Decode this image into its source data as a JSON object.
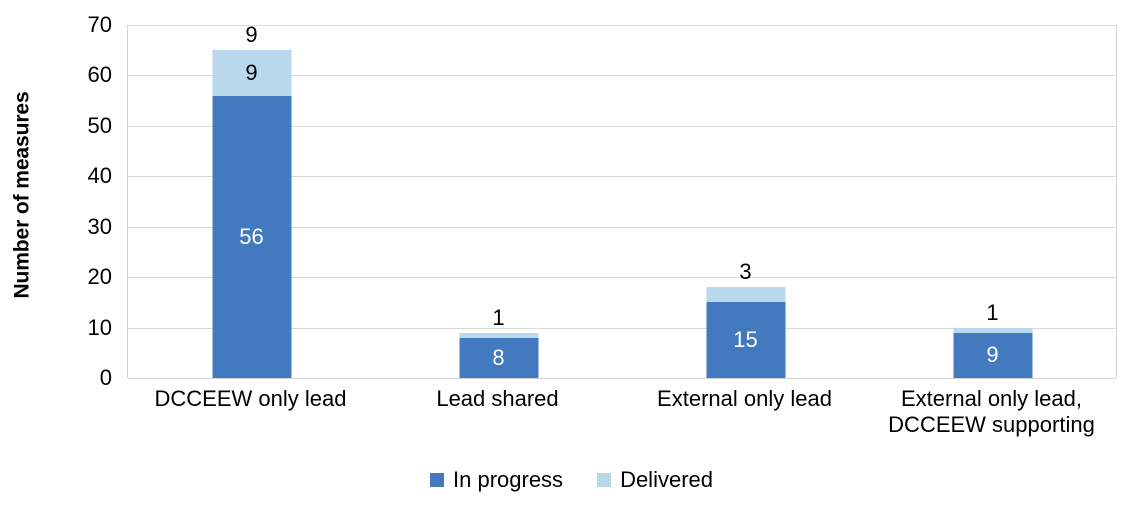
{
  "chart_data": {
    "type": "bar",
    "subtype": "stacked-column",
    "title": "",
    "xlabel": "",
    "ylabel": "Number of measures",
    "ylim": [
      0,
      70
    ],
    "ytick_step": 10,
    "yticks": [
      70,
      60,
      50,
      40,
      30,
      20,
      10,
      0
    ],
    "ytick_labels": [
      "70",
      "60",
      "50",
      "40",
      "30",
      "20",
      "10",
      "0"
    ],
    "grid": "horizontal",
    "legend_position": "bottom",
    "categories": [
      "DCCEEW only lead",
      "Lead shared",
      "External only lead",
      "External only lead, DCCEEW supporting"
    ],
    "category_label_lines": [
      [
        "DCCEEW only lead"
      ],
      [
        "Lead shared"
      ],
      [
        "External only lead"
      ],
      [
        "External only lead,",
        "DCCEEW supporting"
      ]
    ],
    "series": [
      {
        "name": "In progress",
        "color": "#4379BE",
        "values": [
          56,
          8,
          15,
          9
        ],
        "data_labels": [
          "56",
          "8",
          "15",
          "9"
        ],
        "data_label_color": "#FFFFFF",
        "data_label_position": "inside"
      },
      {
        "name": "Delivered",
        "color": "#B8D9EC",
        "values": [
          9,
          1,
          3,
          1
        ],
        "data_labels": [
          "9",
          "1",
          "3",
          "1"
        ],
        "data_label_color": "#000000",
        "data_label_position": "above"
      }
    ],
    "totals": [
      65,
      9,
      18,
      10
    ]
  },
  "legend": {
    "items": [
      {
        "label": "In progress",
        "color": "#4379BE",
        "swatch": "legend-swatch-in-progress"
      },
      {
        "label": "Delivered",
        "color": "#B8D9EC",
        "swatch": "legend-swatch-delivered"
      }
    ]
  },
  "colors": {
    "in_progress": "#4379BE",
    "delivered": "#B8D9EC",
    "gridline": "#D9D9D9",
    "axis_line": "#D4D4D4",
    "text": "#000000",
    "background": "#FFFFFF"
  }
}
